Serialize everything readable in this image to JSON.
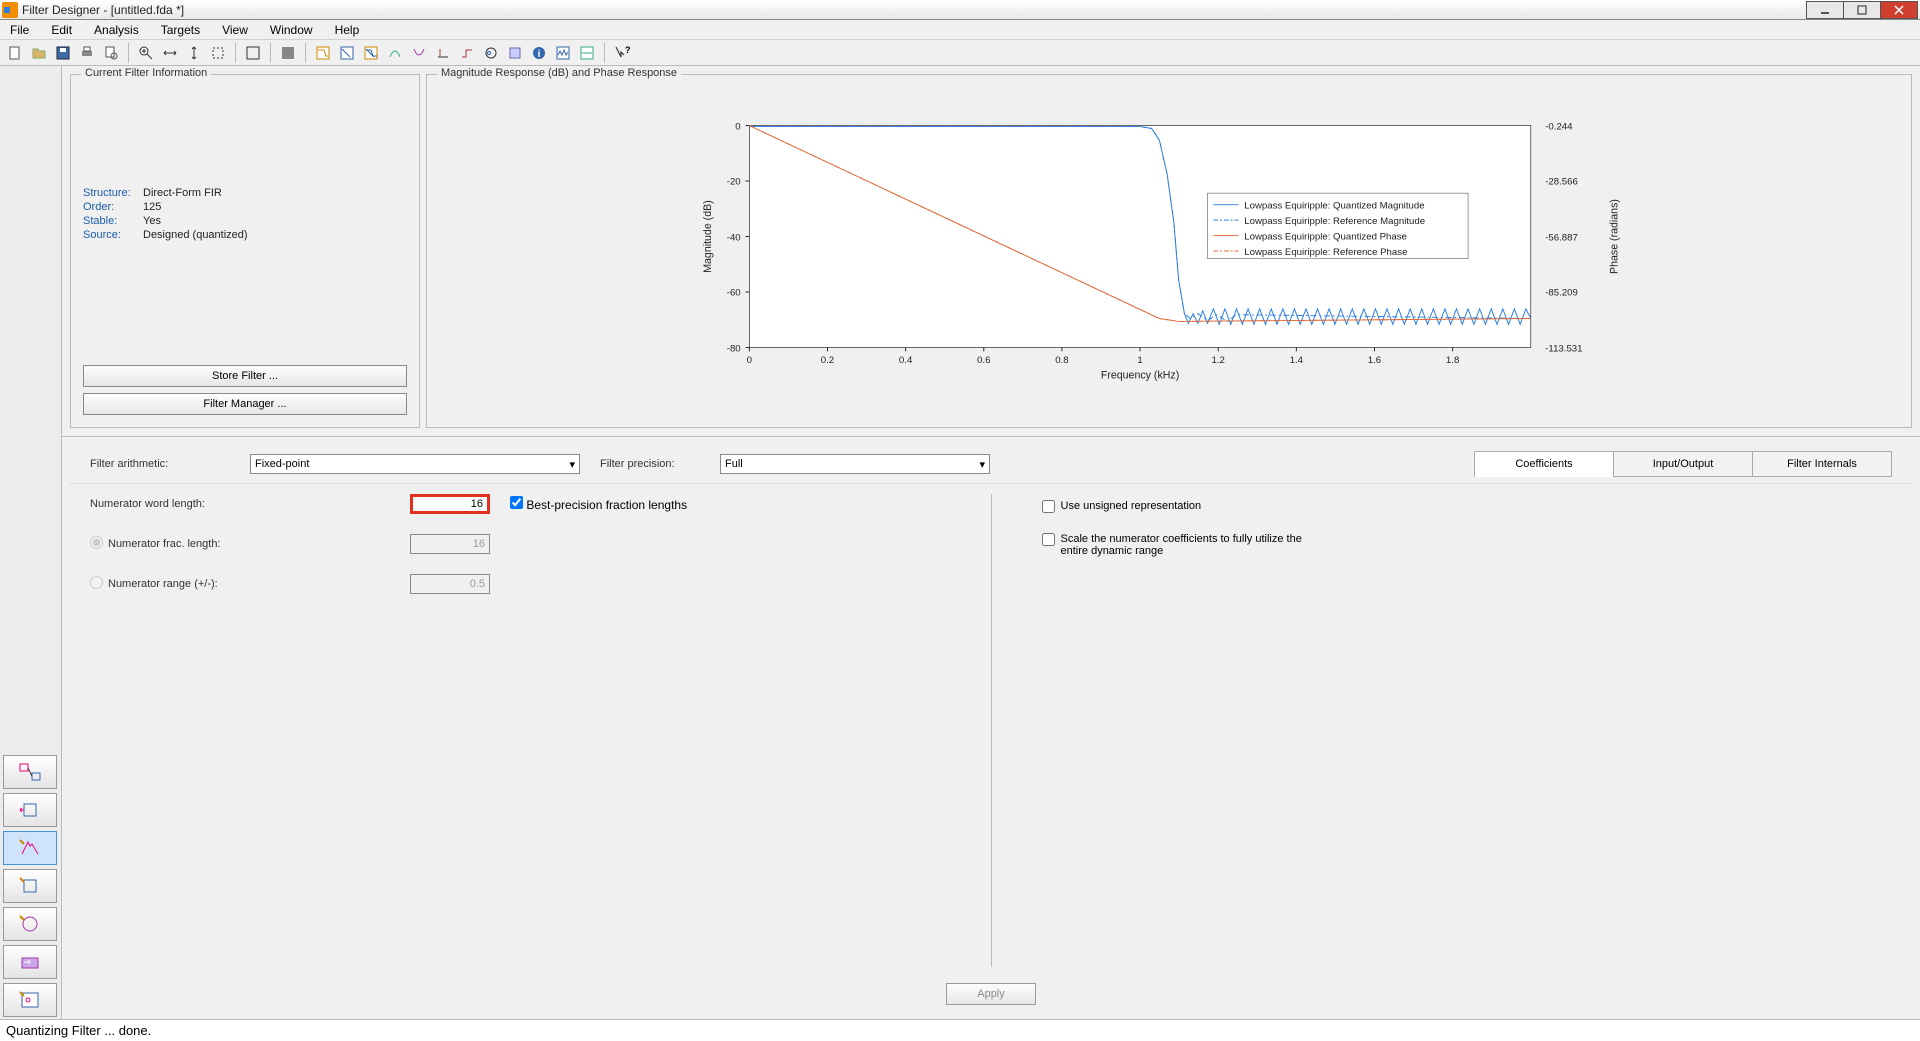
{
  "window": {
    "title": "Filter Designer -  [untitled.fda *]"
  },
  "menu": {
    "items": [
      "File",
      "Edit",
      "Analysis",
      "Targets",
      "View",
      "Window",
      "Help"
    ]
  },
  "filter_info": {
    "legend": "Current Filter Information",
    "rows": [
      {
        "k": "Structure:",
        "v": "Direct-Form FIR"
      },
      {
        "k": "Order:",
        "v": "125"
      },
      {
        "k": "Stable:",
        "v": "Yes"
      },
      {
        "k": "Source:",
        "v": "Designed (quantized)"
      }
    ],
    "store_btn": "Store Filter ...",
    "manager_btn": "Filter Manager ..."
  },
  "plot": {
    "legend": "Magnitude Response (dB) and Phase Response",
    "xlabel": "Frequency (kHz)",
    "ylabel_left": "Magnitude (dB)",
    "ylabel_right": "Phase (radians)",
    "legend_items": [
      "Lowpass Equiripple: Quantized Magnitude",
      "Lowpass Equiripple: Reference Magnitude",
      "Lowpass Equiripple: Quantized Phase",
      "Lowpass Equiripple: Reference Phase"
    ],
    "right_ticks": [
      "-0.244",
      "-28.566",
      "-56.887",
      "-85.209",
      "-113.531"
    ]
  },
  "chart_data": {
    "type": "line",
    "xlabel": "Frequency (kHz)",
    "ylabel": "Magnitude (dB)",
    "y2label": "Phase (radians)",
    "xlim": [
      0,
      2.0
    ],
    "ylim": [
      -80,
      0
    ],
    "y2lim": [
      -113.531,
      -0.244
    ],
    "x_ticks": [
      0,
      0.2,
      0.4,
      0.6,
      0.8,
      1,
      1.2,
      1.4,
      1.6,
      1.8
    ],
    "y_ticks": [
      0,
      -20,
      -40,
      -60,
      -80
    ],
    "y2_ticks": [
      -0.244,
      -28.566,
      -56.887,
      -85.209,
      -113.531
    ],
    "series": [
      {
        "name": "Lowpass Equiripple: Quantized Magnitude",
        "color": "#2a7de1",
        "y_axis": "left",
        "x": [
          0,
          0.2,
          0.4,
          0.6,
          0.8,
          1.0,
          1.05,
          1.1,
          1.15,
          1.2,
          1.3,
          1.4,
          1.5,
          1.6,
          1.7,
          1.8,
          1.9,
          2.0
        ],
        "y": [
          0,
          0,
          0,
          0,
          0,
          0,
          -5,
          -40,
          -65,
          -70,
          -70,
          -70,
          -70,
          -70,
          -70,
          -70,
          -70,
          -70
        ],
        "note": "stopband region (≈1.1–2.0 kHz) oscillates rapidly between ≈-65 and ≈-75 dB"
      },
      {
        "name": "Lowpass Equiripple: Reference Magnitude",
        "color": "#2a7de1",
        "dash": "dashdot",
        "y_axis": "left",
        "x": [
          0,
          0.2,
          0.4,
          0.6,
          0.8,
          1.0,
          1.05,
          1.1,
          1.15,
          1.2,
          1.3,
          1.4,
          1.5,
          1.6,
          1.7,
          1.8,
          1.9,
          2.0
        ],
        "y": [
          0,
          0,
          0,
          0,
          0,
          0,
          -5,
          -40,
          -65,
          -70,
          -70,
          -70,
          -70,
          -70,
          -70,
          -70,
          -70,
          -70
        ],
        "note": "overlaps quantized magnitude; stopband ripple ≈-65 to ≈-75 dB"
      },
      {
        "name": "Lowpass Equiripple: Quantized Phase",
        "color": "#e06a3a",
        "y_axis": "right",
        "x": [
          0,
          0.2,
          0.4,
          0.6,
          0.8,
          1.0,
          1.1,
          1.2,
          1.4,
          1.6,
          1.8,
          2.0
        ],
        "y": [
          -0.244,
          -16,
          -32,
          -48,
          -64,
          -80,
          -85,
          -85,
          -85,
          -85,
          -85,
          -85
        ],
        "note": "linear decrease 0→~1.05 kHz then flat ≈-85 rad with small ripple"
      },
      {
        "name": "Lowpass Equiripple: Reference Phase",
        "color": "#e06a3a",
        "dash": "dashdot",
        "y_axis": "right",
        "x": [
          0,
          0.2,
          0.4,
          0.6,
          0.8,
          1.0,
          1.1,
          1.2,
          1.4,
          1.6,
          1.8,
          2.0
        ],
        "y": [
          -0.244,
          -16,
          -32,
          -48,
          -64,
          -80,
          -85,
          -85,
          -85,
          -85,
          -85,
          -85
        ],
        "note": "overlaps quantized phase"
      }
    ]
  },
  "opts": {
    "arith_label": "Filter arithmetic:",
    "arith_value": "Fixed-point",
    "prec_label": "Filter precision:",
    "prec_value": "Full",
    "tabs": [
      "Coefficients",
      "Input/Output",
      "Filter Internals"
    ]
  },
  "params": {
    "num_word_label": "Numerator word length:",
    "num_word_value": "16",
    "best_prec_label": "Best-precision fraction lengths",
    "num_frac_label": "Numerator frac. length:",
    "num_frac_value": "16",
    "num_range_label": "Numerator range (+/-):",
    "num_range_value": "0.5",
    "unsigned_label": "Use unsigned representation",
    "scale_label": "Scale the numerator coefficients to fully utilize the entire dynamic range"
  },
  "apply_label": "Apply",
  "status": "Quantizing Filter ... done."
}
